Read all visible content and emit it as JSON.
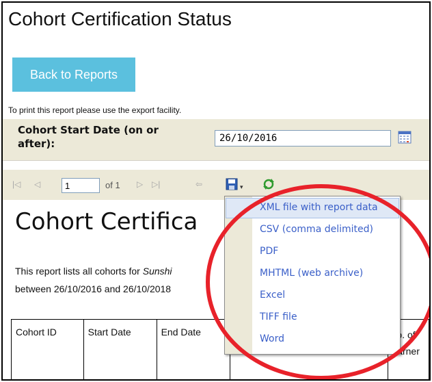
{
  "page": {
    "title": "Cohort Certification Status"
  },
  "back_button": {
    "label": "Back to Reports"
  },
  "print_note": "To print this report please use the export facility.",
  "params": {
    "start_date_label": "Cohort Start Date (on or after):",
    "start_date_value": "26/10/2016"
  },
  "toolbar": {
    "first_page_glyph": "|◁",
    "prev_page_glyph": "◁",
    "current_page": "1",
    "of_pages": "of 1",
    "next_page_glyph": "▷",
    "last_page_glyph": "▷|",
    "back_glyph": "⇦",
    "dropdown_caret": "▾"
  },
  "report": {
    "title": "Cohort Certifica",
    "desc_line1_prefix": "This report lists all cohorts for ",
    "desc_line1_italic": "Sunshi",
    "desc_line2": "between 26/10/2016 and 26/10/2018",
    "columns": [
      "Cohort ID",
      "Start Date",
      "End Date",
      "",
      "No. of learner"
    ]
  },
  "export_menu": {
    "items": [
      "XML file with report data",
      "CSV (comma delimited)",
      "PDF",
      "MHTML (web archive)",
      "Excel",
      "TIFF file",
      "Word"
    ]
  },
  "colors": {
    "accent_button": "#5bc0de",
    "toolbar_bg": "#ece9d8",
    "menu_text": "#3a5fc8",
    "annotation_circle": "#e8222a"
  },
  "icons": {
    "calendar": "calendar-icon",
    "save": "save-icon",
    "refresh": "refresh-icon"
  }
}
